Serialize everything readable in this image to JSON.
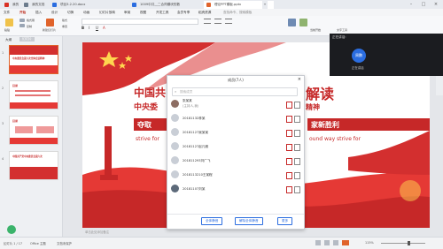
{
  "tabs": [
    {
      "label": "我的",
      "color": "#d93025"
    },
    {
      "label": "我的文档",
      "color": "#6b7b8c"
    },
    {
      "label": "项目3.2.20.docx",
      "color": "#2b6de0"
    },
    {
      "label": "1009中共__二合同模块的数",
      "color": "#2b6de0"
    },
    {
      "label": "理论PPT模板.pptx",
      "color": "#e0632b"
    }
  ],
  "menu": [
    "文件",
    "开始",
    "插入",
    "设计",
    "切换",
    "动画",
    "幻灯片放映",
    "审阅",
    "视图",
    "开发工具",
    "会员专享",
    "稻壳资源",
    "查找命令、搜索模板"
  ],
  "menu_active_index": 1,
  "ribbon_labels": [
    "格式刷",
    "粘贴",
    "复制",
    "新建幻灯片",
    "版式",
    "重置",
    "当前开始",
    "文字工具"
  ],
  "leftpanel": {
    "header_outline": "大纲",
    "header_slides": "幻灯片"
  },
  "slides": [
    {
      "num": "1",
      "title": "中央委员会第六次全体会议精神"
    },
    {
      "num": "2",
      "title": "目录"
    },
    {
      "num": "3",
      "title": "目录"
    },
    {
      "num": "4",
      "title": "中国共产党中央委员会第六次"
    }
  ],
  "slide": {
    "title_left": "中国共",
    "title_right": "解读",
    "subtitle_left": "中央委",
    "subtitle_right": "精神",
    "band_left": "夺取",
    "band_right": "家新胜利",
    "english_left": "strive for",
    "english_right": "ound way strive for"
  },
  "popup": {
    "title": "成员(7人)",
    "search_placeholder": "搜索成员",
    "members": [
      {
        "name": "张某某",
        "sub": "(主持人,我)"
      },
      {
        "name": "20181132林某"
      },
      {
        "name": "20181127吴某某"
      },
      {
        "name": "20181127赵凡雅"
      },
      {
        "name": "201811293刘广飞"
      },
      {
        "name": "2018113210王某程"
      },
      {
        "name": "20181107刘某"
      }
    ],
    "btn_mute_all": "全体静音",
    "btn_unmute_all": "解除全体静音",
    "btn_more": "更多"
  },
  "video": {
    "title": "正在讲话:",
    "name": "周鹏",
    "status": "正在讲话"
  },
  "status": {
    "page": "幻灯片 1 / 17",
    "theme": "Office 主题",
    "protect": "文档未保护",
    "notes": "单击此处添加备注",
    "zoom": "115%"
  },
  "colors": {
    "accent": "#c62828",
    "wps_red": "#d93025",
    "blue": "#2b6de0"
  }
}
